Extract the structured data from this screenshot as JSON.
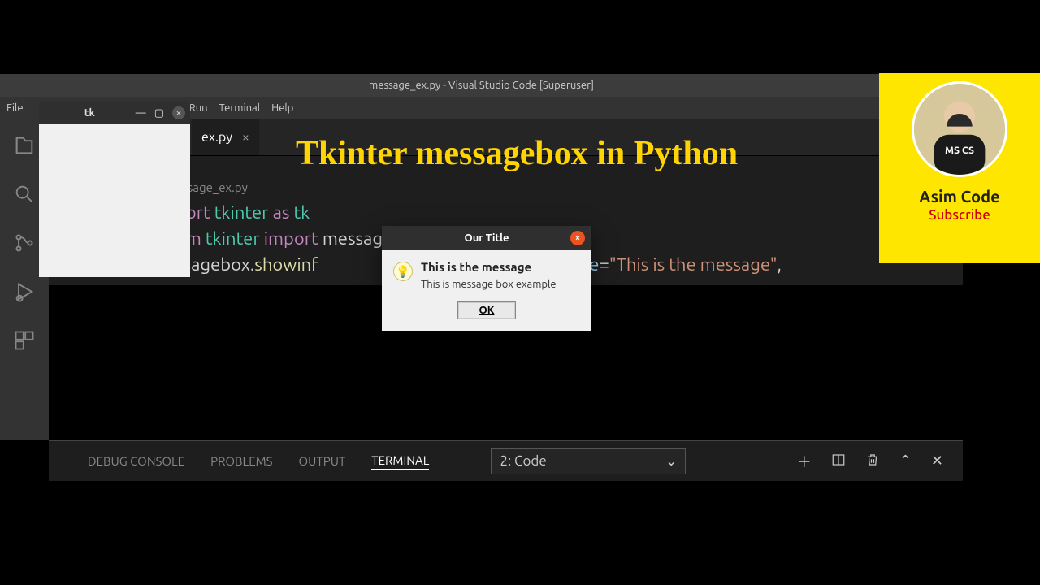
{
  "titlebar": "message_ex.py - Visual Studio Code [Superuser]",
  "menu": {
    "file": "File",
    "run": "Run",
    "terminal": "Terminal",
    "help": "Help"
  },
  "tab": {
    "name": "ex.py",
    "close": "×"
  },
  "overlay_title": "Tkinter messagebox in Python",
  "editor": {
    "path": "essage_ex.py",
    "l1": {
      "a": "port ",
      "b": "tkinter ",
      "c": "as ",
      "d": "tk"
    },
    "l2": {
      "a": "om ",
      "b": "tkinter ",
      "c": "import ",
      "d": "messagebox"
    },
    "l3": {
      "a": "ssagebox.",
      "b": "showinf",
      "c": ",",
      "d": "message",
      "e": "=",
      "f": "\"This is the message\"",
      "g": ","
    }
  },
  "panel": {
    "debug": "DEBUG CONSOLE",
    "problems": "PROBLEMS",
    "output": "OUTPUT",
    "terminal": "TERMINAL",
    "select": "2: Code"
  },
  "tk": {
    "title": "tk",
    "min": "—",
    "max": "▢",
    "close": "×"
  },
  "msgbox": {
    "title": "Our Title",
    "close": "×",
    "heading": "This is the message",
    "detail": "This is message box example",
    "ok": "OK"
  },
  "youtube": {
    "name": "Asim Code",
    "subscribe": "Subscribe",
    "shirt": "MS CS"
  }
}
